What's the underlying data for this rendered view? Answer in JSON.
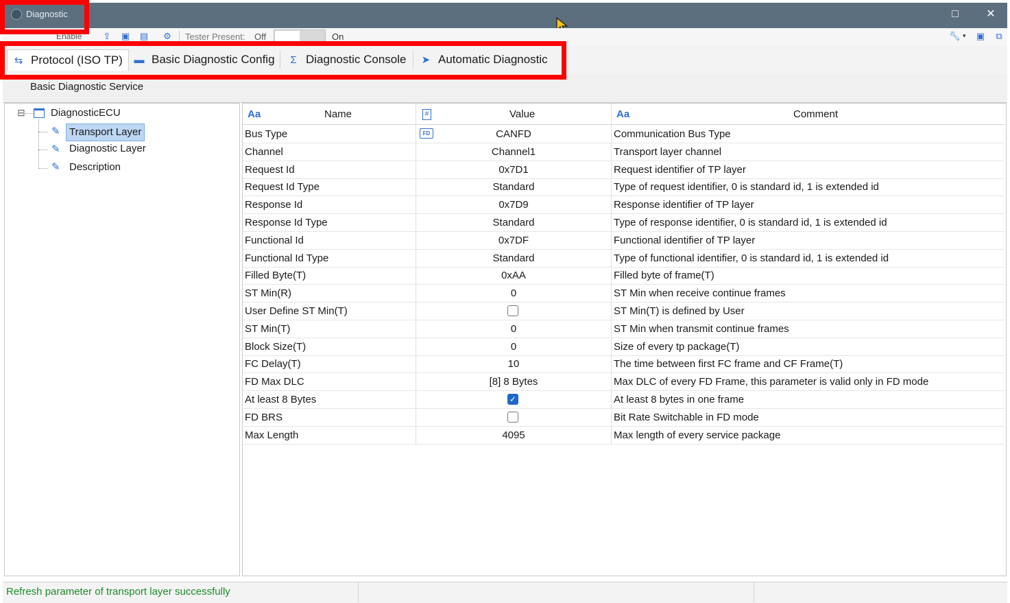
{
  "window": {
    "title": "Diagnostic",
    "maximize_icon": "□",
    "close_icon": "✕"
  },
  "toolbar": {
    "enable_label": "Enable",
    "tester_present_label": "Tester Present:",
    "off_label": "Off",
    "on_label": "On"
  },
  "tabs": [
    {
      "label": "Protocol (ISO TP)",
      "icon": "⇆"
    },
    {
      "label": "Basic Diagnostic Config",
      "icon": "▬"
    },
    {
      "label": "Diagnostic Console",
      "icon": "Σ"
    },
    {
      "label": "Automatic Diagnostic",
      "icon": "➤"
    }
  ],
  "section": {
    "title": "Basic Diagnostic Service"
  },
  "tree": {
    "root": {
      "label": "DiagnosticECU",
      "expand": "⊟"
    },
    "children": [
      {
        "label": "Transport Layer",
        "selected": true
      },
      {
        "label": "Diagnostic Layer",
        "selected": false
      },
      {
        "label": "Description",
        "selected": false
      }
    ]
  },
  "grid": {
    "headers": {
      "name": "Name",
      "value": "Value",
      "comment": "Comment",
      "text_icon": "Aa",
      "num_icon": "#"
    },
    "fd_icon": "FD",
    "rows": [
      {
        "name": "Bus Type",
        "value": "CANFD",
        "comment": "Communication Bus Type"
      },
      {
        "name": "Channel",
        "value": "Channel1",
        "comment": "Transport layer channel"
      },
      {
        "name": "Request Id",
        "value": "0x7D1",
        "comment": "Request identifier of TP layer"
      },
      {
        "name": "Request Id Type",
        "value": "Standard",
        "comment": "Type of request identifier, 0 is standard id, 1 is extended id"
      },
      {
        "name": "Response Id",
        "value": "0x7D9",
        "comment": "Response identifier of TP layer"
      },
      {
        "name": "Response Id Type",
        "value": "Standard",
        "comment": "Type of response identifier, 0 is standard id, 1 is extended id"
      },
      {
        "name": "Functional Id",
        "value": "0x7DF",
        "comment": "Functional identifier of TP layer"
      },
      {
        "name": "Functional Id Type",
        "value": "Standard",
        "comment": "Type of functional identifier, 0 is standard id, 1 is extended id"
      },
      {
        "name": "Filled Byte(T)",
        "value": "0xAA",
        "comment": "Filled byte of frame(T)"
      },
      {
        "name": "ST Min(R)",
        "value": "0",
        "comment": "ST Min when receive continue frames"
      },
      {
        "name": "User Define ST Min(T)",
        "value": "",
        "checkbox": false,
        "comment": "ST Min(T) is defined by User"
      },
      {
        "name": "ST Min(T)",
        "value": "0",
        "comment": "ST Min when transmit continue frames"
      },
      {
        "name": "Block Size(T)",
        "value": "0",
        "comment": "Size of every tp package(T)"
      },
      {
        "name": "FC Delay(T)",
        "value": "10",
        "comment": "The time between first FC frame and CF Frame(T)"
      },
      {
        "name": "FD Max DLC",
        "value": "[8]  8 Bytes",
        "comment": "Max DLC of every FD Frame, this parameter is valid only in FD mode"
      },
      {
        "name": "At least 8 Bytes",
        "value": "",
        "checkbox": true,
        "comment": "At least 8 bytes in one frame"
      },
      {
        "name": "FD BRS",
        "value": "",
        "checkbox": false,
        "comment": "Bit Rate Switchable in FD mode"
      },
      {
        "name": "Max Length",
        "value": "4095",
        "comment": "Max length of every service package"
      }
    ]
  },
  "status": {
    "message": "Refresh parameter of transport layer successfully",
    "color": "#1d8a2a"
  },
  "colors": {
    "titlebar": "#5b6f7f",
    "accent": "#2f6fd0",
    "highlight": "#ff0000",
    "selection": "#bcd6f3"
  }
}
